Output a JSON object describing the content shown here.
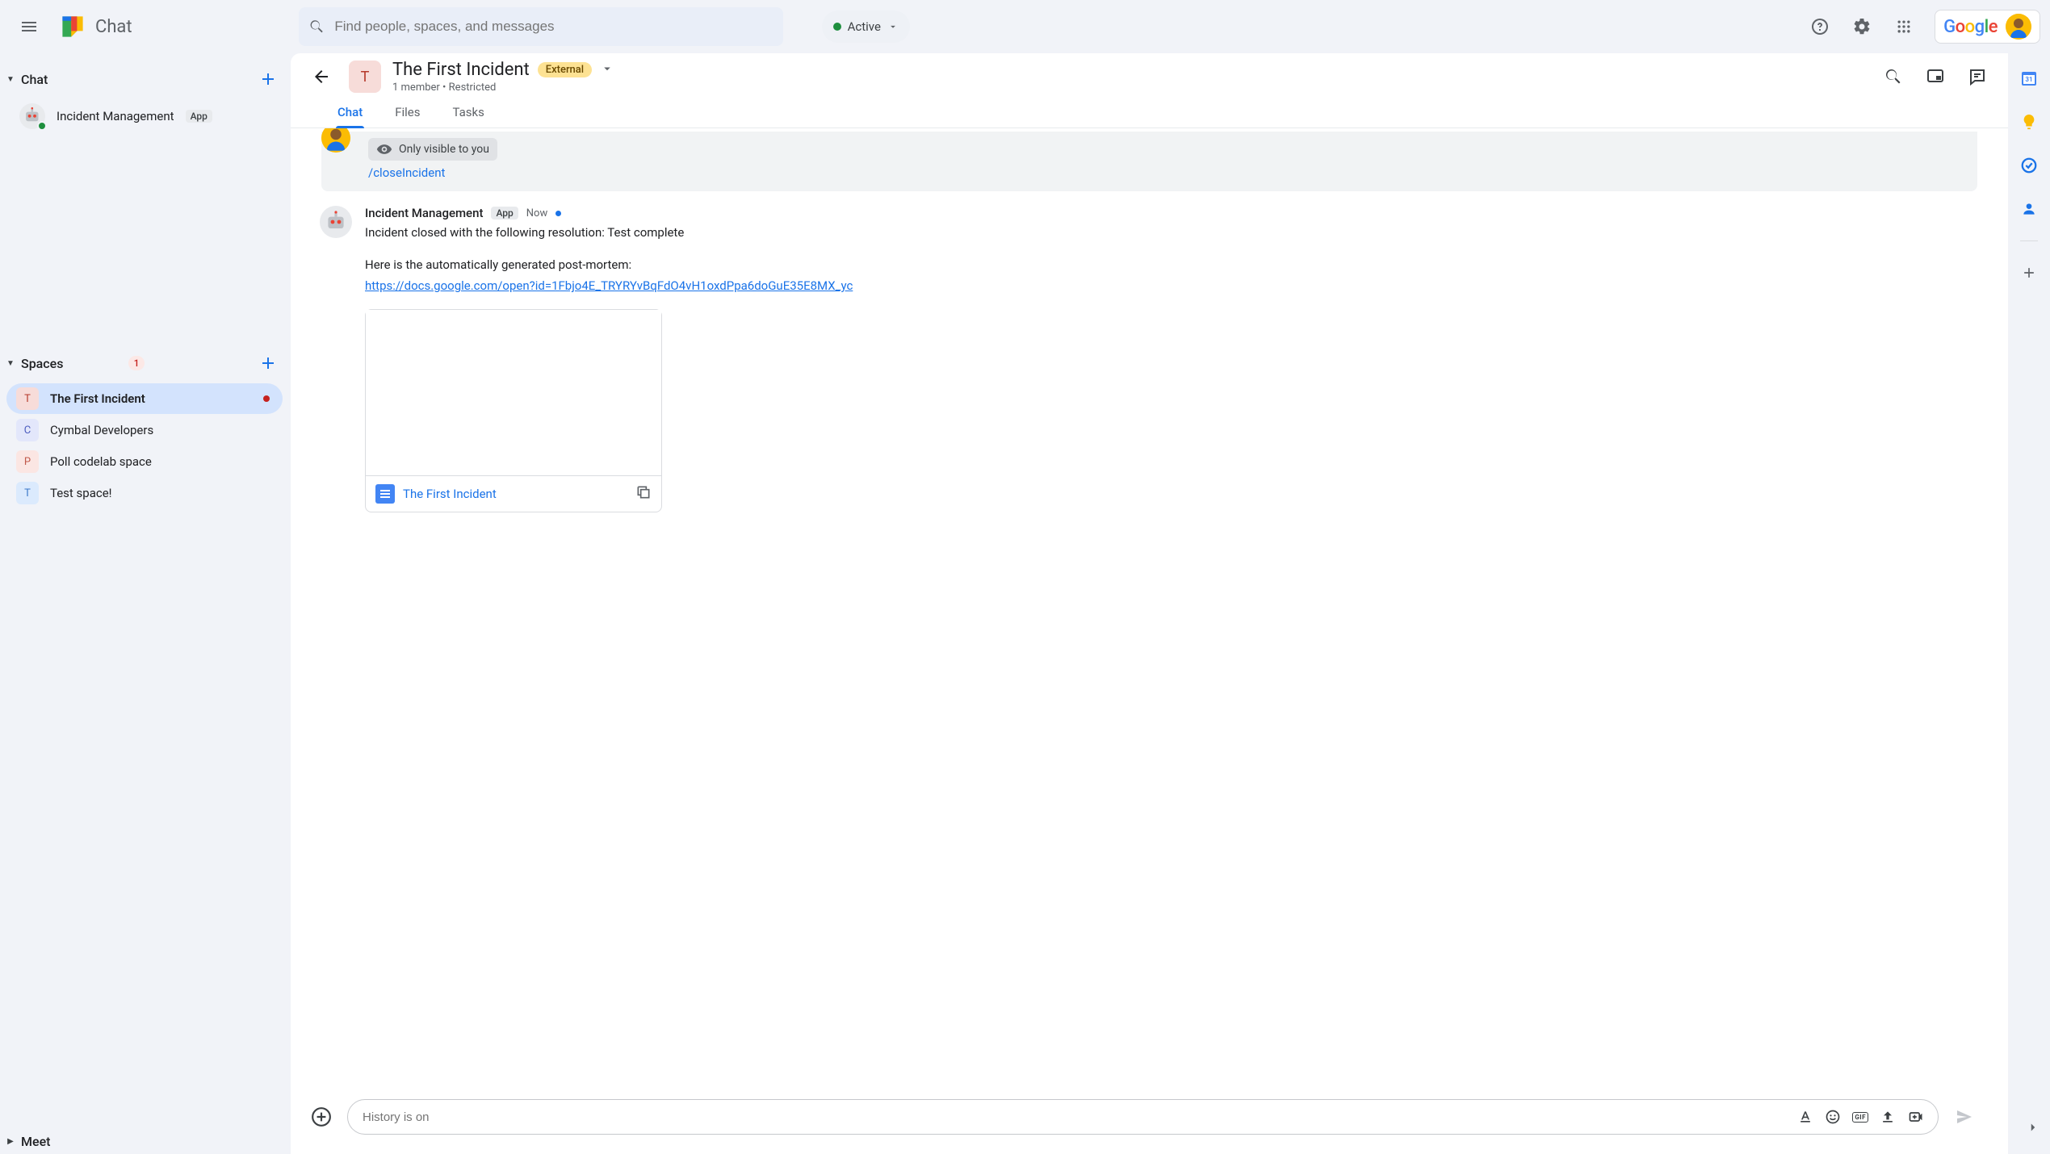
{
  "product": "Chat",
  "search": {
    "placeholder": "Find people, spaces, and messages"
  },
  "status": {
    "label": "Active"
  },
  "sidebar": {
    "chat_section": "Chat",
    "spaces_section": "Spaces",
    "spaces_badge": "1",
    "meet_section": "Meet",
    "chat_items": [
      {
        "name": "Incident Management",
        "chip": "App"
      }
    ],
    "spaces": [
      {
        "initial": "T",
        "bg": "#f7dcd9",
        "fg": "#b63a2b",
        "label": "The First Incident",
        "active": true,
        "unread": true
      },
      {
        "initial": "C",
        "bg": "#e3e7fb",
        "fg": "#4d5dbf",
        "label": "Cymbal Developers"
      },
      {
        "initial": "P",
        "bg": "#fbe6e3",
        "fg": "#c0584a",
        "label": "Poll codelab space"
      },
      {
        "initial": "T",
        "bg": "#dbeafd",
        "fg": "#3b78c9",
        "label": "Test space!"
      }
    ]
  },
  "space": {
    "initial": "T",
    "title": "The First Incident",
    "external": "External",
    "subtitle": "1 member  •  Restricted"
  },
  "tabs": {
    "chat": "Chat",
    "files": "Files",
    "tasks": "Tasks"
  },
  "visible_only": "Only visible to you",
  "slash": "/closeIncident",
  "message": {
    "sender": "Incident Management",
    "chip": "App",
    "time": "Now",
    "line1": "Incident closed with the following resolution: Test complete",
    "line2": "Here is the automatically generated post-mortem:",
    "link": "https://docs.google.com/open?id=1Fbjo4E_TRYRYvBqFdO4vH1oxdPpa6doGuE35E8MX_yc"
  },
  "doc": {
    "title": "The First Incident"
  },
  "composer": {
    "placeholder": "History is on"
  },
  "rail": {
    "calendar_day": "31"
  }
}
